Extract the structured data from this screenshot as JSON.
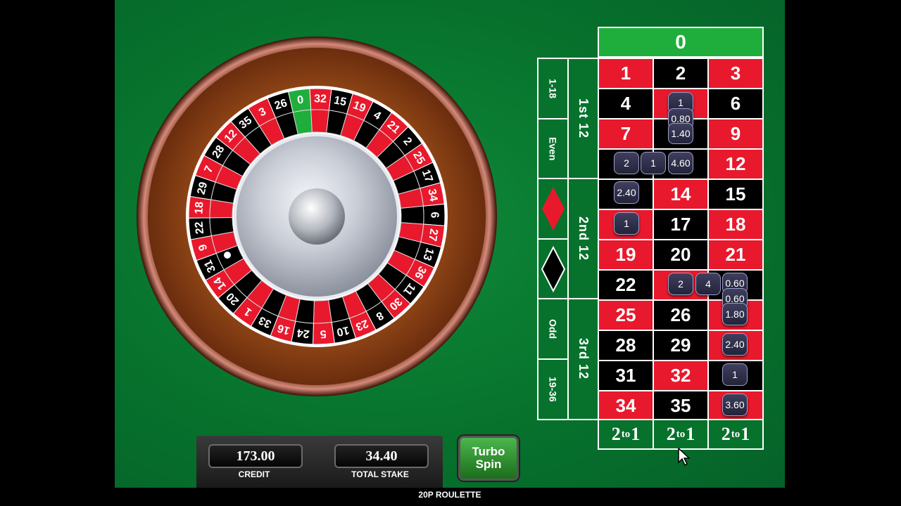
{
  "title": "20P ROULETTE",
  "credit": {
    "value": "173.00",
    "label": "CREDIT"
  },
  "stake": {
    "value": "34.40",
    "label": "TOTAL STAKE"
  },
  "turbo_button": {
    "line1": "Turbo",
    "line2": "Spin"
  },
  "wheel": {
    "sequence": [
      "0",
      "32",
      "15",
      "19",
      "4",
      "21",
      "2",
      "25",
      "17",
      "34",
      "6",
      "27",
      "13",
      "36",
      "11",
      "30",
      "8",
      "23",
      "10",
      "5",
      "24",
      "16",
      "33",
      "1",
      "20",
      "14",
      "31",
      "9",
      "22",
      "18",
      "29",
      "7",
      "28",
      "12",
      "35",
      "3",
      "26"
    ],
    "colors": {
      "red": "#e8192c",
      "black": "#000000",
      "green": "#1fae3c"
    }
  },
  "table": {
    "zero": "0",
    "rows": [
      [
        "1",
        "2",
        "3"
      ],
      [
        "4",
        "5",
        "6"
      ],
      [
        "7",
        "8",
        "9"
      ],
      [
        "10",
        "11",
        "12"
      ],
      [
        "13",
        "14",
        "15"
      ],
      [
        "16",
        "17",
        "18"
      ],
      [
        "19",
        "20",
        "21"
      ],
      [
        "22",
        "23",
        "24"
      ],
      [
        "25",
        "26",
        "27"
      ],
      [
        "28",
        "29",
        "30"
      ],
      [
        "31",
        "32",
        "33"
      ],
      [
        "34",
        "35",
        "36"
      ]
    ],
    "red_numbers": [
      "1",
      "3",
      "5",
      "7",
      "9",
      "12",
      "14",
      "16",
      "18",
      "19",
      "21",
      "23",
      "25",
      "27",
      "30",
      "32",
      "34",
      "36"
    ],
    "dozens": [
      "1st 12",
      "2nd 12",
      "3rd 12"
    ],
    "outside": [
      "1-18",
      "Even",
      "red-diamond",
      "black-diamond",
      "Odd",
      "19-36"
    ],
    "columns": [
      "2",
      "to",
      "1"
    ]
  },
  "chips": [
    "1",
    "0.80",
    "1.40",
    "2",
    "1",
    "4.60",
    "2.40",
    "1",
    "2",
    "4",
    "0.60",
    "0.60",
    "1.80",
    "2.40",
    "1",
    "3.60"
  ]
}
